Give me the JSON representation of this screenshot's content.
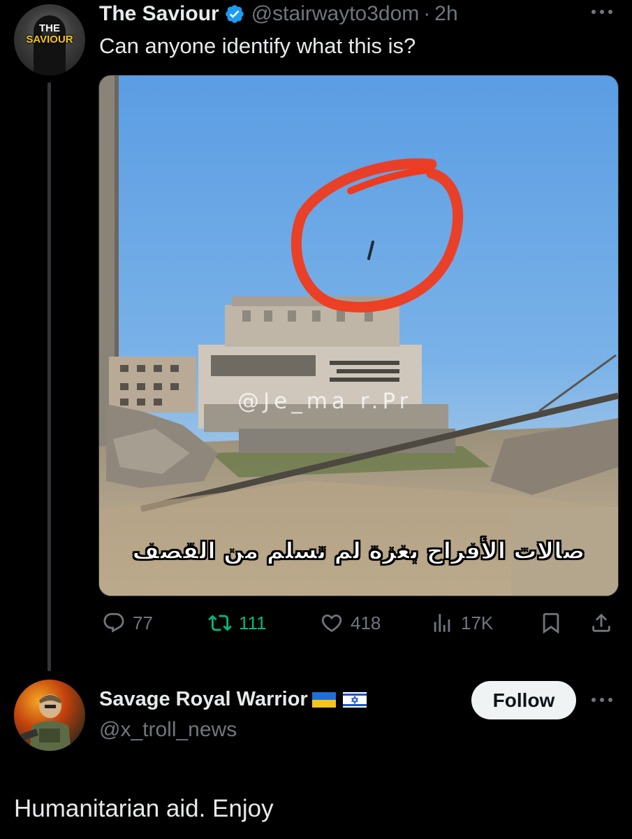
{
  "tweet": {
    "author_name": "The Saviour",
    "author_handle": "@stairwayto3dom",
    "separator": "·",
    "time": "2h",
    "text": "Can anyone identify what this is?",
    "avatar_logo_line1": "THE",
    "avatar_logo_line2": "SAVIOUR",
    "media": {
      "watermark": "@Je_ma  r.Pr",
      "caption": "صالات الأفراح بغزة لم تسلم من القصف"
    },
    "stats": {
      "replies": "77",
      "retweets": "111",
      "likes": "418",
      "views": "17K"
    },
    "colors": {
      "retweet_active": "#00ba7c",
      "verified": "#1d9bf0",
      "muted": "#71767b"
    }
  },
  "reply": {
    "author_name": "Savage Royal Warrior",
    "author_handle": "@x_troll_news",
    "follow_label": "Follow",
    "text": "Humanitarian aid. Enjoy",
    "flags": [
      "ukraine-flag",
      "israel-flag"
    ]
  }
}
